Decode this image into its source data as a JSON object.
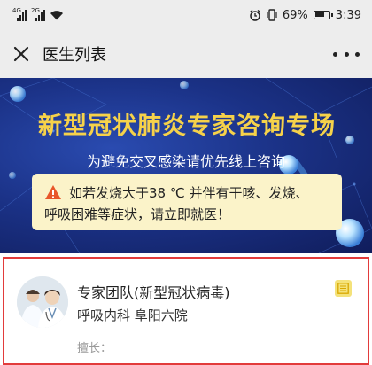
{
  "status_bar": {
    "signal1_tag": "4G",
    "signal2_tag": "2G",
    "battery_percent": "69%",
    "time": "3:39",
    "battery_level": 0.69
  },
  "nav": {
    "title": "医生列表"
  },
  "banner": {
    "title": "新型冠状肺炎专家咨询专场",
    "subtitle": "为避免交叉感染请优先线上咨询",
    "notice_line1": "如若发烧大于38 ℃ 并伴有干咳、发烧、",
    "notice_line2": "呼吸困难等症状，请立即就医！",
    "title_color": "#f6d24a",
    "notice_bg": "#fbf3c9"
  },
  "doctor": {
    "name": "专家团队(新型冠状病毒)",
    "department": "呼吸内科  阜阳六院",
    "specialty": "擅长：",
    "badge_icon": "image-badge-icon",
    "highlight_color": "#e23b3b"
  }
}
